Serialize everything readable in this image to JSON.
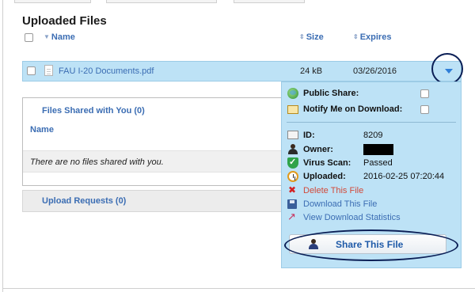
{
  "page": {
    "title": "Uploaded Files"
  },
  "table": {
    "columns": {
      "name": "Name",
      "size": "Size",
      "expires": "Expires"
    },
    "file": {
      "name": "FAU I-20 Documents.pdf",
      "size": "24 kB",
      "expires": "03/26/2016"
    }
  },
  "details_panel": {
    "public_share_label": "Public Share:",
    "notify_label": "Notify Me on Download:",
    "id_label": "ID:",
    "id_value": "8209",
    "owner_label": "Owner:",
    "virus_scan_label": "Virus Scan:",
    "virus_scan_value": "Passed",
    "uploaded_label": "Uploaded:",
    "uploaded_value": "2016-02-25 07:20:44",
    "delete_link": "Delete This File",
    "download_link": "Download This File",
    "stats_link": "View Download Statistics",
    "share_button": "Share This File"
  },
  "shared_with_you": {
    "heading": "Files Shared with You (0)",
    "column_name": "Name",
    "empty_message": "There are no files shared with you."
  },
  "upload_requests": {
    "heading": "Upload Requests (0)"
  },
  "colors": {
    "row_highlight": "#bde2f6",
    "link_blue": "#3b6db3",
    "annotation_ring": "#0b1f56",
    "delete_red": "#d24a3a"
  },
  "icons": [
    "document-icon",
    "chevron-down-icon",
    "globe-icon",
    "envelope-icon",
    "id-card-icon",
    "user-icon",
    "shield-check-icon",
    "clock-icon",
    "delete-x-icon",
    "floppy-disk-icon",
    "chart-icon",
    "share-user-icon"
  ]
}
